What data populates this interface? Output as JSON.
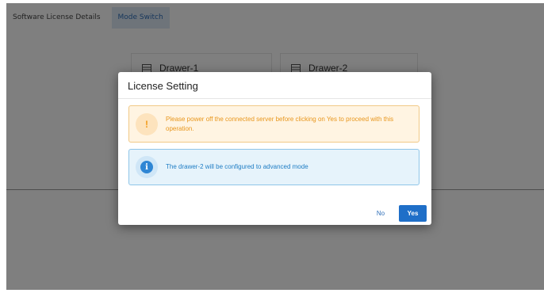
{
  "tabs": [
    {
      "label": "Software License Details"
    },
    {
      "label": "Mode Switch"
    }
  ],
  "drawers": [
    {
      "label": "Drawer-1",
      "icon": "server-icon"
    },
    {
      "label": "Drawer-2",
      "icon": "server-icon"
    }
  ],
  "dialog": {
    "title": "License Setting",
    "warning": {
      "icon": "warning-icon",
      "symbol": "!",
      "message": "Please power off the connected server before clicking on Yes to proceed with this operation."
    },
    "info": {
      "icon": "info-icon",
      "symbol": "i",
      "message": "The drawer-2 will be configured to advanced mode"
    },
    "no_label": "No",
    "yes_label": "Yes"
  },
  "colors": {
    "accent": "#1f6fc8",
    "warning_text": "#e8961c",
    "info_text": "#1f7dc4"
  }
}
